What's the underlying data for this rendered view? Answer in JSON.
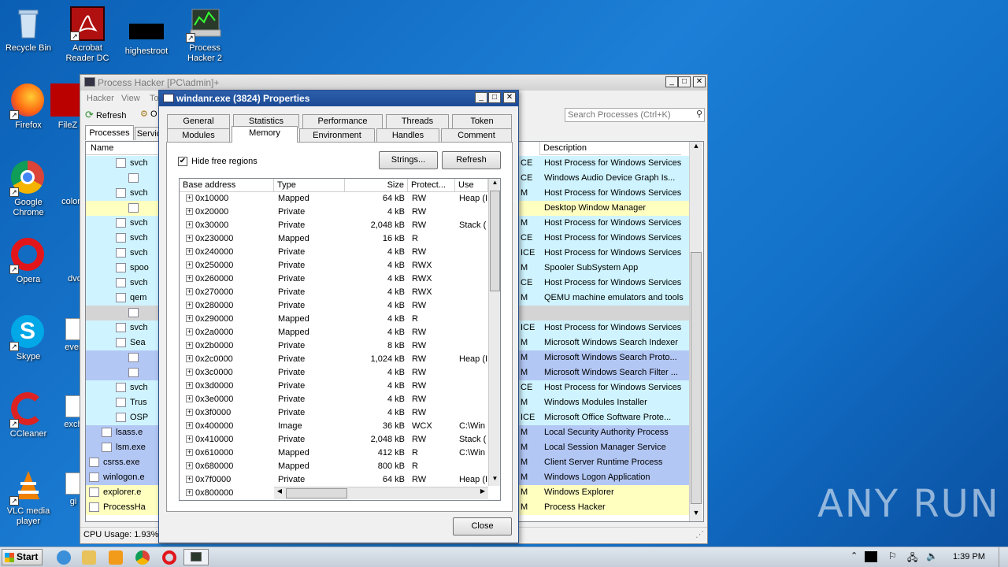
{
  "desktop": {
    "icons": [
      {
        "label": "Recycle Bin"
      },
      {
        "label": "Acrobat Reader DC"
      },
      {
        "label": "highestroot"
      },
      {
        "label": "Process Hacker 2"
      },
      {
        "label": "Firefox"
      },
      {
        "label": "FileZ"
      },
      {
        "label": "Google Chrome"
      },
      {
        "label": "color"
      },
      {
        "label": "Opera"
      },
      {
        "label": "dvd"
      },
      {
        "label": "Skype"
      },
      {
        "label": "ever"
      },
      {
        "label": "CCleaner"
      },
      {
        "label": "exch"
      },
      {
        "label": "VLC media player"
      },
      {
        "label": "gi"
      }
    ],
    "watermark": "ANY RUN"
  },
  "main_window": {
    "title": "Process Hacker [PC\\admin]+",
    "menu": [
      "Hacker",
      "View",
      "To"
    ],
    "toolbar": {
      "refresh": "Refresh",
      "options": "O"
    },
    "tabs": [
      "Processes",
      "Servic"
    ],
    "search_placeholder": "Search Processes (Ctrl+K)",
    "columns": {
      "name": "Name",
      "description": "Description"
    },
    "processes": [
      {
        "name": "svch",
        "desc": "Host Process for Windows Services",
        "mid": "CE"
      },
      {
        "name": "",
        "desc": "Windows Audio Device Graph Is...",
        "mid": "CE"
      },
      {
        "name": "svch",
        "desc": "Host Process for Windows Services",
        "mid": "M"
      },
      {
        "name": "",
        "desc": "Desktop Window Manager",
        "mid": ""
      },
      {
        "name": "svch",
        "desc": "Host Process for Windows Services",
        "mid": "M"
      },
      {
        "name": "svch",
        "desc": "Host Process for Windows Services",
        "mid": "CE"
      },
      {
        "name": "svch",
        "desc": "Host Process for Windows Services",
        "mid": "ICE"
      },
      {
        "name": "spoo",
        "desc": "Spooler SubSystem App",
        "mid": "M"
      },
      {
        "name": "svch",
        "desc": "Host Process for Windows Services",
        "mid": "CE"
      },
      {
        "name": "qem",
        "desc": "QEMU machine emulators and tools",
        "mid": "M"
      },
      {
        "name": "",
        "desc": "",
        "mid": ""
      },
      {
        "name": "svch",
        "desc": "Host Process for Windows Services",
        "mid": "ICE"
      },
      {
        "name": "Sea",
        "desc": "Microsoft Windows Search Indexer",
        "mid": "M"
      },
      {
        "name": "",
        "desc": "Microsoft Windows Search Proto...",
        "mid": "M"
      },
      {
        "name": "",
        "desc": "Microsoft Windows Search Filter ...",
        "mid": "M"
      },
      {
        "name": "svch",
        "desc": "Host Process for Windows Services",
        "mid": "CE"
      },
      {
        "name": "Trus",
        "desc": "Windows Modules Installer",
        "mid": "M"
      },
      {
        "name": "OSP",
        "desc": "Microsoft Office Software Prote...",
        "mid": "ICE"
      },
      {
        "name": "lsass.e",
        "desc": "Local Security Authority Process",
        "mid": "M"
      },
      {
        "name": "lsm.exe",
        "desc": "Local Session Manager Service",
        "mid": "M"
      },
      {
        "name": "csrss.exe",
        "desc": "Client Server Runtime Process",
        "mid": "M"
      },
      {
        "name": "winlogon.e",
        "desc": "Windows Logon Application",
        "mid": "M"
      },
      {
        "name": "explorer.e",
        "desc": "Windows Explorer",
        "mid": "M"
      },
      {
        "name": "ProcessHa",
        "desc": "Process Hacker",
        "mid": "M"
      }
    ],
    "status": "CPU Usage: 1.93%"
  },
  "dialog": {
    "title": "windanr.exe (3824) Properties",
    "tabs_row1": [
      "General",
      "Statistics",
      "Performance",
      "Threads",
      "Token"
    ],
    "tabs_row2": [
      "Modules",
      "Memory",
      "Environment",
      "Handles",
      "Comment"
    ],
    "hide_free_label": "Hide free regions",
    "strings_button": "Strings...",
    "refresh_button": "Refresh",
    "close_button": "Close",
    "columns": {
      "base": "Base address",
      "type": "Type",
      "size": "Size",
      "protect": "Protect...",
      "use": "Use"
    },
    "rows": [
      {
        "base": "0x10000",
        "type": "Mapped",
        "size": "64 kB",
        "protect": "RW",
        "use": "Heap (I"
      },
      {
        "base": "0x20000",
        "type": "Private",
        "size": "4 kB",
        "protect": "RW",
        "use": ""
      },
      {
        "base": "0x30000",
        "type": "Private",
        "size": "2,048 kB",
        "protect": "RW",
        "use": "Stack ("
      },
      {
        "base": "0x230000",
        "type": "Mapped",
        "size": "16 kB",
        "protect": "R",
        "use": ""
      },
      {
        "base": "0x240000",
        "type": "Private",
        "size": "4 kB",
        "protect": "RW",
        "use": ""
      },
      {
        "base": "0x250000",
        "type": "Private",
        "size": "4 kB",
        "protect": "RWX",
        "use": ""
      },
      {
        "base": "0x260000",
        "type": "Private",
        "size": "4 kB",
        "protect": "RWX",
        "use": ""
      },
      {
        "base": "0x270000",
        "type": "Private",
        "size": "4 kB",
        "protect": "RWX",
        "use": ""
      },
      {
        "base": "0x280000",
        "type": "Private",
        "size": "4 kB",
        "protect": "RW",
        "use": ""
      },
      {
        "base": "0x290000",
        "type": "Mapped",
        "size": "4 kB",
        "protect": "R",
        "use": ""
      },
      {
        "base": "0x2a0000",
        "type": "Mapped",
        "size": "4 kB",
        "protect": "RW",
        "use": ""
      },
      {
        "base": "0x2b0000",
        "type": "Private",
        "size": "8 kB",
        "protect": "RW",
        "use": ""
      },
      {
        "base": "0x2c0000",
        "type": "Private",
        "size": "1,024 kB",
        "protect": "RW",
        "use": "Heap (I"
      },
      {
        "base": "0x3c0000",
        "type": "Private",
        "size": "4 kB",
        "protect": "RW",
        "use": ""
      },
      {
        "base": "0x3d0000",
        "type": "Private",
        "size": "4 kB",
        "protect": "RW",
        "use": ""
      },
      {
        "base": "0x3e0000",
        "type": "Private",
        "size": "4 kB",
        "protect": "RW",
        "use": ""
      },
      {
        "base": "0x3f0000",
        "type": "Private",
        "size": "4 kB",
        "protect": "RW",
        "use": ""
      },
      {
        "base": "0x400000",
        "type": "Image",
        "size": "36 kB",
        "protect": "WCX",
        "use": "C:\\Win"
      },
      {
        "base": "0x410000",
        "type": "Private",
        "size": "2,048 kB",
        "protect": "RW",
        "use": "Stack ("
      },
      {
        "base": "0x610000",
        "type": "Mapped",
        "size": "412 kB",
        "protect": "R",
        "use": "C:\\Win"
      },
      {
        "base": "0x680000",
        "type": "Mapped",
        "size": "800 kB",
        "protect": "R",
        "use": ""
      },
      {
        "base": "0x7f0000",
        "type": "Private",
        "size": "64 kB",
        "protect": "RW",
        "use": "Heap (I"
      },
      {
        "base": "0x800000",
        "type": "",
        "size": "",
        "protect": "",
        "use": ""
      }
    ]
  },
  "taskbar": {
    "start": "Start",
    "clock": "1:39 PM"
  },
  "colors": {
    "service_row": "#cff4ff",
    "own_row": "#ffffc0",
    "system_row": "#b3c7f5",
    "gray_row": "#d4d4d4",
    "dialog_title": "#2c5fab"
  }
}
